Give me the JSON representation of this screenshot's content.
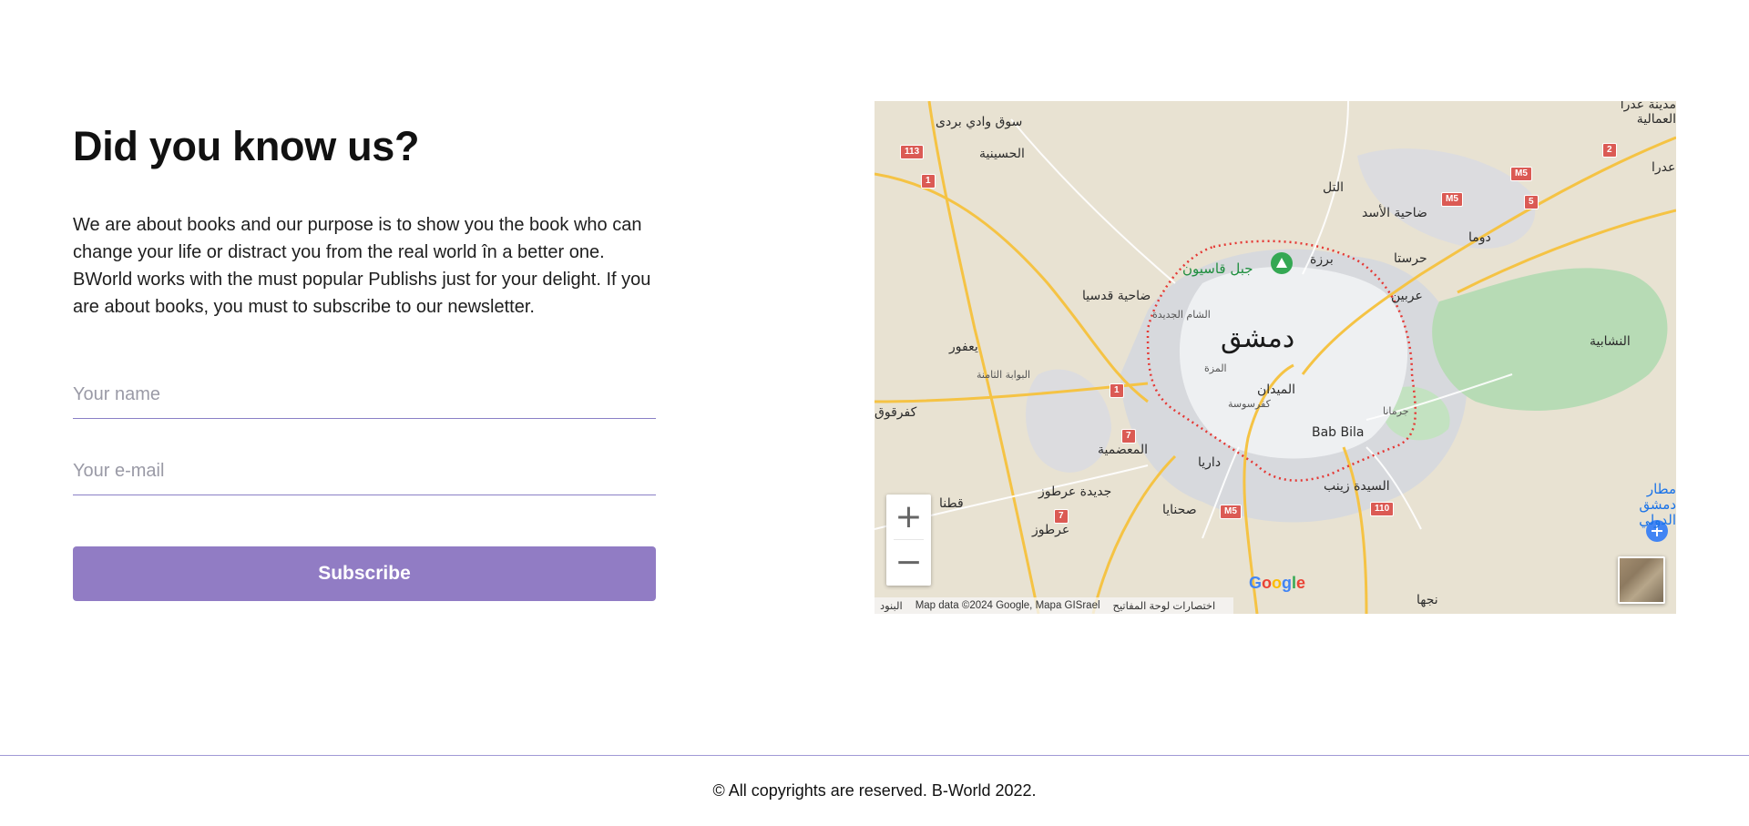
{
  "about": {
    "title": "Did you know us?",
    "description": "We are about books and our purpose is to show you the book who can change your life or distract you from the real world în a better one. BWorld works with the must popular Publishs just for your delight. If you are about books, you must to subscribe to our newsletter."
  },
  "form": {
    "name_placeholder": "Your name",
    "email_placeholder": "Your e-mail",
    "subscribe_label": "Subscribe"
  },
  "map": {
    "zoom_in": "+",
    "zoom_out": "−",
    "logo": {
      "g1": "G",
      "o1": "o",
      "o2": "o",
      "g2": "g",
      "l": "l",
      "e": "e"
    },
    "attribution": {
      "terms": "البنود",
      "data": "Map data ©2024 Google, Mapa GISrael",
      "shortcuts": "اختصارات لوحة المفاتيح"
    },
    "labels": {
      "city": "دمشق",
      "souq_wadi_barada": "سوق وادي بردى",
      "husseiniyeh": "الحسينية",
      "tall": "التل",
      "dahiyat_assad": "ضاحية الأسد",
      "douma": "دوما",
      "harasta": "حرستا",
      "barzeh": "برزة",
      "jabal_qasioun": "جبل قاسيون",
      "dahiyat_qudsaya": "ضاحية قدسيا",
      "sham_jadida": "الشام الجديدة",
      "arbin": "عربين",
      "yafour": "يعفور",
      "mezzeh": "المزة",
      "bawaba_thamina": "البوابة الثامنة",
      "nashabiyeh": "النشابية",
      "midan": "الميدان",
      "kafr_sousa": "كفرسوسة",
      "jaramana": "جرمانا",
      "kafr_qouq": "كفرقوق",
      "muadamiyeh": "المعضمية",
      "babbila": "Bab Bila",
      "daraya": "داريا",
      "jdeidet_artouz": "جديدة عرطوز",
      "sayyida_zaynab": "السيدة زينب",
      "qatana": "قطنا",
      "sahnaya": "صحنايا",
      "artouz": "عرطوز",
      "najha": "نجها",
      "airport": "مطار دمشق الدولي",
      "adra_al_ummaliya": "مدينة عدرا العمالية",
      "adra": "عدرا"
    },
    "shields": [
      "113",
      "1",
      "M5",
      "M5",
      "5",
      "2",
      "1",
      "7",
      "7",
      "M5",
      "110"
    ]
  },
  "footer": {
    "copyright": "© All copyrights are reserved. B-World 2022."
  }
}
